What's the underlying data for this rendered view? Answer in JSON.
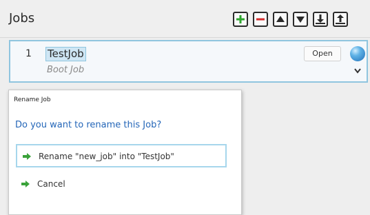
{
  "header": {
    "title": "Jobs"
  },
  "toolbar": [
    {
      "icon": "add-icon"
    },
    {
      "icon": "remove-icon"
    },
    {
      "icon": "move-up-icon"
    },
    {
      "icon": "move-down-icon"
    },
    {
      "icon": "import-icon"
    },
    {
      "icon": "export-icon"
    }
  ],
  "job": {
    "number": "1",
    "name": "TestJob",
    "subtitle": "Boot Job",
    "open_label": "Open"
  },
  "dialog": {
    "title": "Rename Job",
    "question": "Do you want to rename this Job?",
    "options": [
      {
        "label": "Rename \"new_job\" into \"TestJob\""
      },
      {
        "label": "Cancel"
      }
    ]
  },
  "colors": {
    "accent": "#2466b8",
    "arrow": "#3aa23a",
    "selection_border": "#8fc5df"
  }
}
